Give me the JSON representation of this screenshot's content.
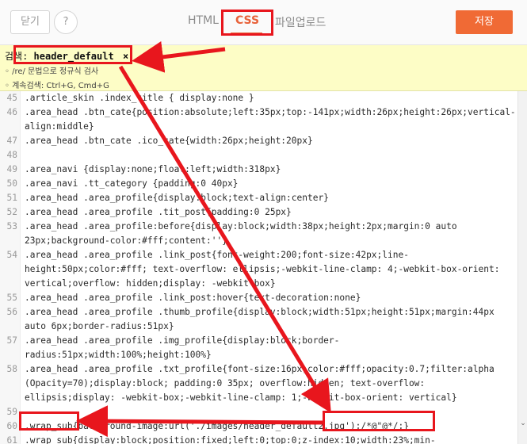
{
  "toolbar": {
    "close_label": "닫기",
    "help_label": "?",
    "tabs": [
      {
        "label": "HTML"
      },
      {
        "label": "CSS"
      },
      {
        "label": "파일업로드"
      }
    ],
    "save_label": "저장"
  },
  "search": {
    "prefix": "검색:",
    "term": "header_default",
    "clear": "×",
    "hint_regex": "◦ /re/ 문법으로 정규식 검사",
    "hint_next": "◦ 계속검색: Ctrl+G, Cmd+G"
  },
  "code": {
    "lines": [
      {
        "n": "45",
        "text": ".article_skin .index_title { display:none }"
      },
      {
        "n": "46",
        "text": ".area_head .btn_cate{position:absolute;left:35px;top:-141px;width:26px;height:26px;vertical-"
      },
      {
        "n": "",
        "text": "align:middle}"
      },
      {
        "n": "47",
        "text": ".area_head .btn_cate .ico_cate{width:26px;height:20px}"
      },
      {
        "n": "48",
        "text": ""
      },
      {
        "n": "49",
        "text": ".area_navi {display:none;float:left;width:318px}"
      },
      {
        "n": "50",
        "text": ".area_navi .tt_category {padding:0 40px}"
      },
      {
        "n": "51",
        "text": ".area_head .area_profile{display:block;text-align:center}"
      },
      {
        "n": "52",
        "text": ".area_head .area_profile .tit_post{padding:0 25px}"
      },
      {
        "n": "53",
        "text": ".area_head .area_profile:before{display:block;width:38px;height:2px;margin:0 auto"
      },
      {
        "n": "",
        "text": "23px;background-color:#fff;content:''}"
      },
      {
        "n": "54",
        "text": ".area_head .area_profile .link_post{font-weight:200;font-size:42px;line-"
      },
      {
        "n": "",
        "text": "height:50px;color:#fff; text-overflow: ellipsis;-webkit-line-clamp: 4;-webkit-box-orient:"
      },
      {
        "n": "",
        "text": "vertical;overflow: hidden;display: -webkit-box}"
      },
      {
        "n": "55",
        "text": ".area_head .area_profile .link_post:hover{text-decoration:none}"
      },
      {
        "n": "56",
        "text": ".area_head .area_profile .thumb_profile{display:block;width:51px;height:51px;margin:44px"
      },
      {
        "n": "",
        "text": "auto 6px;border-radius:51px}"
      },
      {
        "n": "57",
        "text": ".area_head .area_profile .img_profile{display:block;border-"
      },
      {
        "n": "",
        "text": "radius:51px;width:100%;height:100%}"
      },
      {
        "n": "58",
        "text": ".area_head .area_profile .txt_profile{font-size:16px;color:#fff;opacity:0.7;filter:alpha"
      },
      {
        "n": "",
        "text": "(Opacity=70);display:block; padding:0 35px; overflow:hidden; text-overflow:"
      },
      {
        "n": "",
        "text": "ellipsis;display: -webkit-box;-webkit-line-clamp: 1;-webkit-box-orient: vertical}"
      },
      {
        "n": "59",
        "text": ""
      },
      {
        "n": "60",
        "text": ".wrap_sub{background-image:url('./images/header_default2.jpg');/*@\"@*/;}"
      },
      {
        "n": "61",
        "text": ".wrap_sub{display:block;position:fixed;left:0;top:0;z-index:10;width:23%;min-"
      }
    ]
  },
  "annotations": {
    "color": "#e8161d"
  }
}
